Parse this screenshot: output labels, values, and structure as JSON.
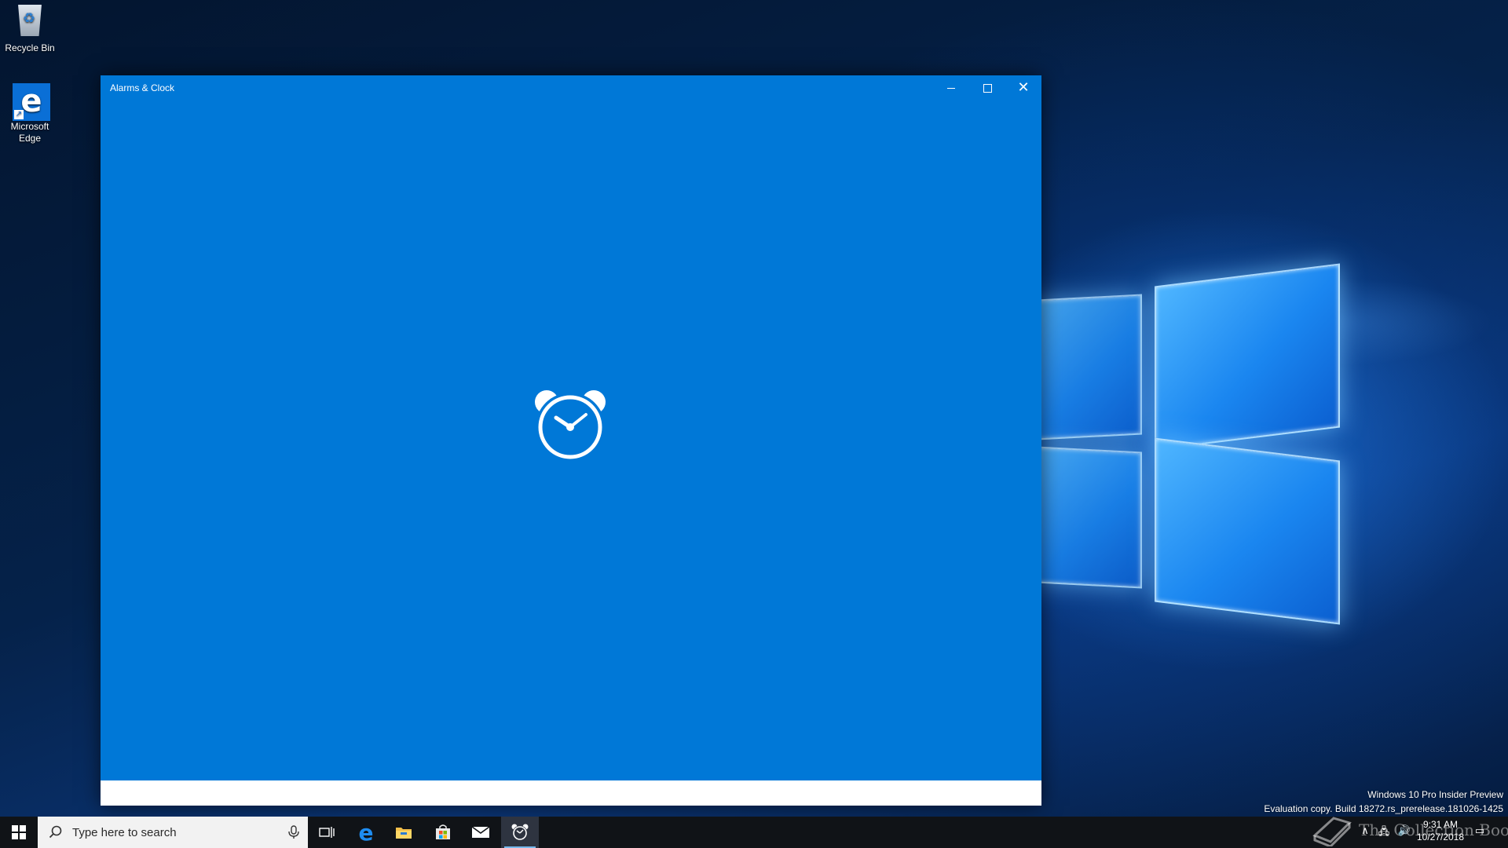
{
  "desktop": {
    "icons": [
      {
        "label": "Recycle Bin",
        "icon": "recycle-bin-icon"
      },
      {
        "label": "Microsoft Edge",
        "icon": "edge-icon"
      }
    ]
  },
  "window": {
    "title": "Alarms & Clock",
    "controls": {
      "minimize": "minimize-icon",
      "maximize": "maximize-icon",
      "close": "close-icon"
    },
    "splash_icon": "alarm-clock-icon",
    "colors": {
      "accent": "#0078d7",
      "footer": "#ffffff"
    }
  },
  "taskbar": {
    "search_placeholder": "Type here to search",
    "pinned": [
      "start-icon",
      "task-view-icon",
      "edge-icon",
      "file-explorer-icon",
      "store-icon",
      "mail-icon",
      "alarms-clock-icon"
    ],
    "active_app": "alarms-clock-icon",
    "colors": {
      "background": "#101317",
      "active_indicator": "#76b9ed"
    }
  },
  "system": {
    "watermark_line1": "Windows 10 Pro Insider Preview",
    "watermark_line2": "Evaluation copy. Build 18272.rs_prerelease.181026-1425",
    "time": "9:31 AM",
    "date": "10/27/2018",
    "brand": "The Collection Book"
  }
}
